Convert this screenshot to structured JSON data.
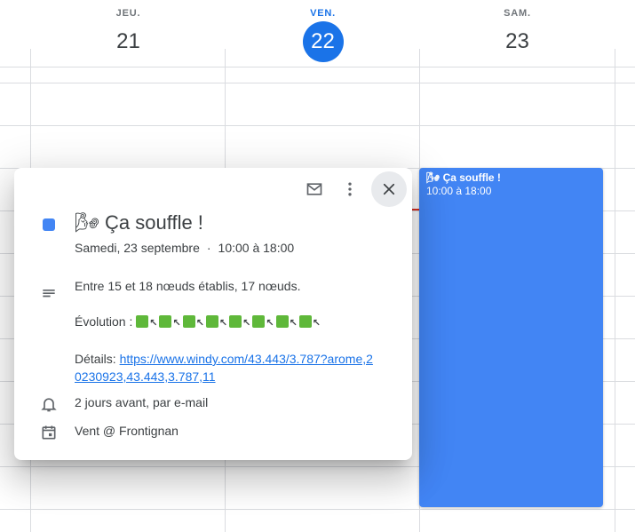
{
  "header": {
    "days": [
      {
        "name": "JEU.",
        "number": "21",
        "today": false
      },
      {
        "name": "VEN.",
        "number": "22",
        "today": true
      },
      {
        "name": "SAM.",
        "number": "23",
        "today": false
      }
    ]
  },
  "event_block": {
    "title": "🌬 Ça souffle !",
    "time": "10:00 à 18:00",
    "color": "#4285f4"
  },
  "popover": {
    "actions": {
      "email_icon": "email-icon",
      "more_icon": "more-vert-icon",
      "close_icon": "close-icon"
    },
    "color": "#4285f4",
    "title": "🌬 Ça souffle !",
    "date": "Samedi, 23 septembre",
    "separator": "·",
    "time": "10:00 à 18:00",
    "description": {
      "line1": "Entre 15 et 18 nœuds établis, 17 nœuds.",
      "evolution_label": "Évolution : ",
      "evolution_steps": 8,
      "details_label": "Détails: ",
      "details_link": "https://www.windy.com/43.443/3.787?arome,20230923,43.443,3.787,11"
    },
    "reminder": "2 jours avant, par e-mail",
    "calendar": "Vent @ Frontignan"
  }
}
